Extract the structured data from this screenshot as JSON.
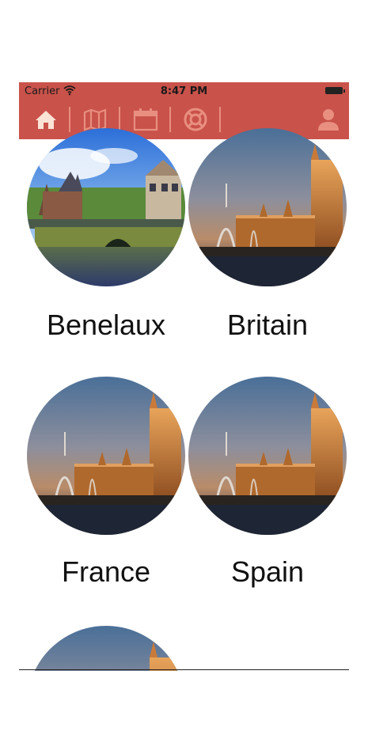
{
  "status_bar": {
    "carrier": "Carrier",
    "time": "8:47 PM"
  },
  "nav_bar": {
    "background": "#c9524a",
    "active_icon_color": "#fbe3d6",
    "inactive_icon_color": "#e88f80",
    "items": [
      {
        "icon": "home-icon",
        "active": true
      },
      {
        "icon": "map-icon",
        "active": false
      },
      {
        "icon": "calendar-icon",
        "active": false
      },
      {
        "icon": "lifebuoy-icon",
        "active": false
      },
      {
        "icon": "profile-icon",
        "active": false
      }
    ]
  },
  "regions": [
    {
      "name": "Benelaux",
      "image": "amsterdam-canal-photo"
    },
    {
      "name": "Britain",
      "image": "westminster-night-photo"
    },
    {
      "name": "France",
      "image": "westminster-night-photo"
    },
    {
      "name": "Spain",
      "image": "westminster-night-photo"
    },
    {
      "name": "",
      "image": "westminster-night-photo"
    }
  ]
}
